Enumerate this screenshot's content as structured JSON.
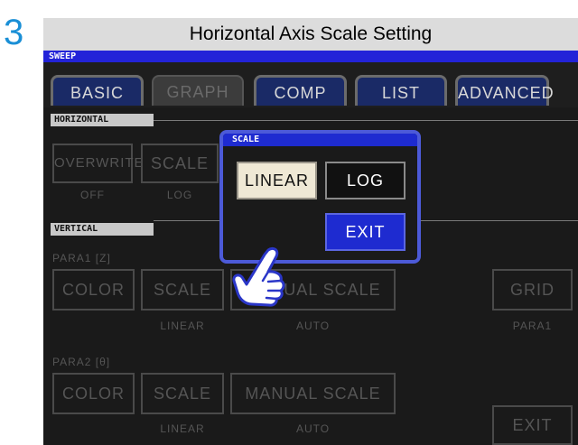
{
  "step_number": "3",
  "instruction_title": "Horizontal Axis Scale Setting",
  "status_bar": {
    "label": "SWEEP"
  },
  "tabs": [
    {
      "label": "BASIC",
      "active": true
    },
    {
      "label": "GRAPH",
      "active": false
    },
    {
      "label": "COMP",
      "active": true
    },
    {
      "label": "LIST",
      "active": true
    },
    {
      "label": "ADVANCED",
      "active": true
    }
  ],
  "horizontal": {
    "section_label": "HORIZONTAL",
    "overwrite": {
      "label": "OVERWRITE",
      "value": "OFF"
    },
    "scale": {
      "label": "SCALE",
      "value": "LOG"
    }
  },
  "vertical": {
    "section_label": "VERTICAL",
    "para1": {
      "label": "PARA1 [Z]",
      "color_label": "COLOR",
      "scale_label": "SCALE",
      "scale_value": "LINEAR",
      "manual_label": "MANUAL SCALE",
      "manual_value": "AUTO",
      "grid_label": "GRID",
      "grid_value": "PARA1"
    },
    "para2": {
      "label": "PARA2 [θ]",
      "color_label": "COLOR",
      "scale_label": "SCALE",
      "scale_value": "LINEAR",
      "manual_label": "MANUAL SCALE",
      "manual_value": "AUTO"
    }
  },
  "exit_label": "EXIT",
  "scale_popup": {
    "title": "SCALE",
    "options": [
      "LINEAR",
      "LOG"
    ],
    "selected": "LINEAR",
    "exit_label": "EXIT"
  },
  "colors": {
    "accent_blue": "#1e2bd0",
    "tab_active": "#1a2a66",
    "popup_border": "#4c5ad8",
    "step_number": "#1a8fd6"
  },
  "icons": {
    "pointer": "hand-pointer-icon"
  }
}
